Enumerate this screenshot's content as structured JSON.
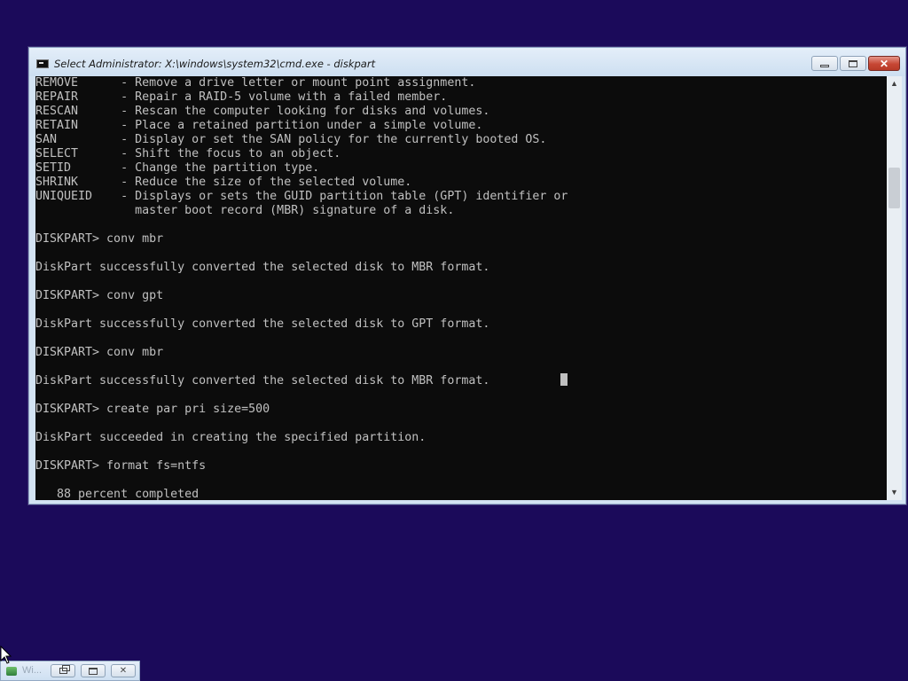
{
  "window": {
    "title": "Select Administrator: X:\\windows\\system32\\cmd.exe - diskpart",
    "minimize_glyph": "",
    "maximize_glyph": "",
    "close_glyph": "✕"
  },
  "console": {
    "lines": [
      "REMOVE      - Remove a drive letter or mount point assignment.",
      "REPAIR      - Repair a RAID-5 volume with a failed member.",
      "RESCAN      - Rescan the computer looking for disks and volumes.",
      "RETAIN      - Place a retained partition under a simple volume.",
      "SAN         - Display or set the SAN policy for the currently booted OS.",
      "SELECT      - Shift the focus to an object.",
      "SETID       - Change the partition type.",
      "SHRINK      - Reduce the size of the selected volume.",
      "UNIQUEID    - Displays or sets the GUID partition table (GPT) identifier or",
      "              master boot record (MBR) signature of a disk.",
      "",
      "DISKPART> conv mbr",
      "",
      "DiskPart successfully converted the selected disk to MBR format.",
      "",
      "DISKPART> conv gpt",
      "",
      "DiskPart successfully converted the selected disk to GPT format.",
      "",
      "DISKPART> conv mbr",
      "",
      "DiskPart successfully converted the selected disk to MBR format.",
      "",
      "DISKPART> create par pri size=500",
      "",
      "DiskPart succeeded in creating the specified partition.",
      "",
      "DISKPART> format fs=ntfs",
      "",
      "   88 percent completed"
    ]
  },
  "scrollbar": {
    "up_glyph": "▲",
    "down_glyph": "▼"
  },
  "minimized_window": {
    "title": "Wi...",
    "close_glyph": "✕"
  },
  "colors": {
    "desktop": "#1b0a5a",
    "console_bg": "#0c0c0c",
    "console_text": "#c0c0c0",
    "close_button": "#c64734"
  }
}
